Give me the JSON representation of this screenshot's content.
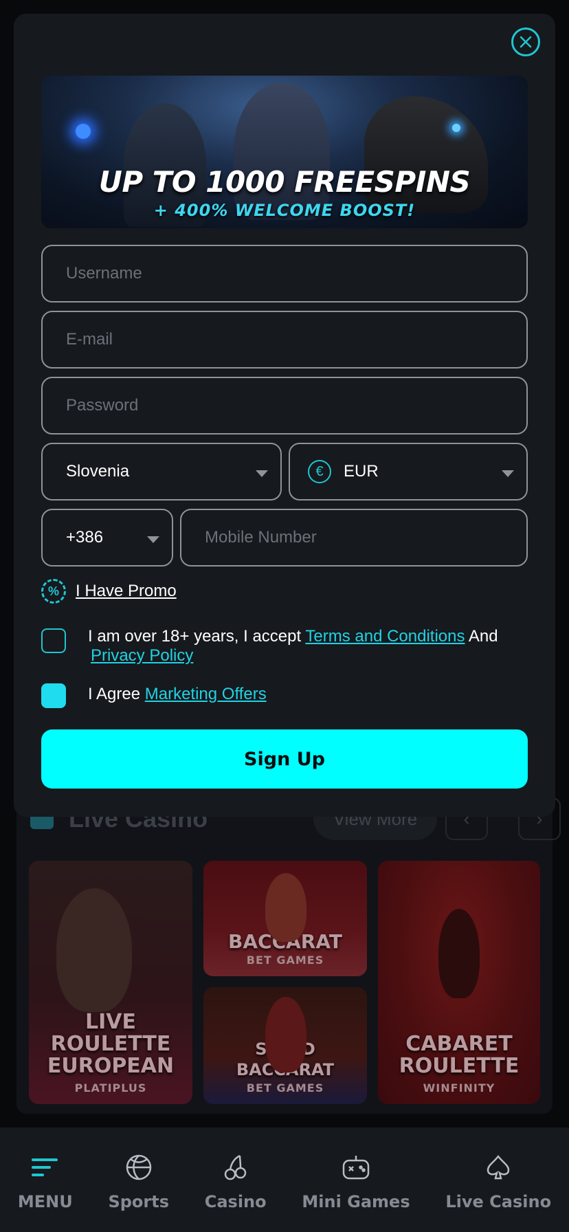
{
  "background": {
    "section_title": "Live Casino",
    "view_more": "View More",
    "prev_arrow": "‹",
    "next_arrow": "›",
    "games": [
      {
        "line1": "LIVE ROULETTE",
        "line2": "EUROPEAN",
        "provider": "PLATIPLUS"
      },
      {
        "line1": "BACCARAT",
        "line2": "",
        "provider": "BET GAMES"
      },
      {
        "line1": "SPEED BACCARAT",
        "line2": "",
        "provider": "BET GAMES"
      },
      {
        "line1": "CABARET",
        "line2": "ROULETTE",
        "provider": "WINFINITY"
      }
    ]
  },
  "modal": {
    "banner": {
      "title": "UP TO 1000 FREESPINS",
      "subtitle": "+ 400% WELCOME BOOST!"
    },
    "fields": {
      "username_placeholder": "Username",
      "email_placeholder": "E-mail",
      "password_placeholder": "Password",
      "country_value": "Slovenia",
      "currency_symbol": "€",
      "currency_value": "EUR",
      "phone_code": "+386",
      "mobile_placeholder": "Mobile Number"
    },
    "promo": {
      "icon_symbol": "%",
      "label": "I Have Promo"
    },
    "terms": {
      "text": "I am over 18+ years, I accept",
      "terms_link": "Terms and Conditions",
      "and": "And",
      "privacy_link": "Privacy Policy",
      "checked": false
    },
    "marketing": {
      "text": "I Agree",
      "link": "Marketing Offers",
      "checked": true
    },
    "signup_label": "Sign Up"
  },
  "bottom_nav": [
    {
      "label": "MENU",
      "icon": "menu-icon"
    },
    {
      "label": "Sports",
      "icon": "basketball-icon"
    },
    {
      "label": "Casino",
      "icon": "cherries-icon"
    },
    {
      "label": "Mini Games",
      "icon": "gamepad-icon"
    },
    {
      "label": "Live Casino",
      "icon": "spade-icon"
    }
  ],
  "colors": {
    "accent": "#00ffff",
    "link": "#1fd3e3",
    "modal_bg": "#16191e",
    "page_bg": "#08090b"
  }
}
